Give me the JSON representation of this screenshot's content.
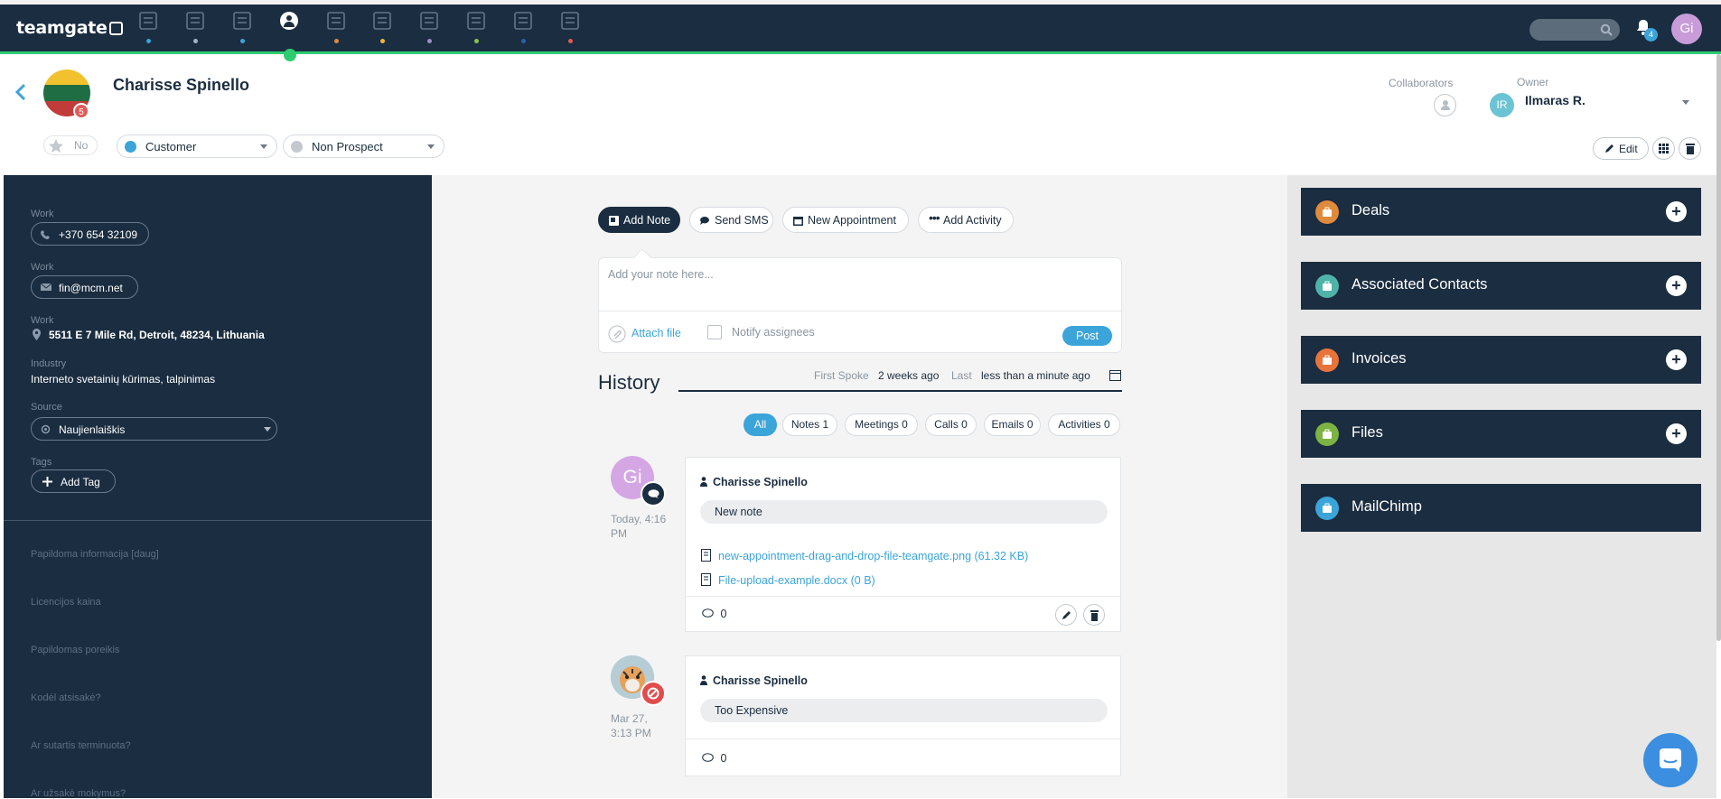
{
  "topbar": {
    "logo": "teamgate",
    "notifications_count": "4",
    "user_initials": "Gi",
    "nav_icons": [
      {
        "name": "dashboard-icon",
        "color": "#3ba4d9"
      },
      {
        "name": "target-icon",
        "color": "#9fb5c8"
      },
      {
        "name": "companies-icon",
        "color": "#3ba4d9"
      },
      {
        "name": "people-icon",
        "color": "#2ecc71"
      },
      {
        "name": "deals-icon",
        "color": "#e08a3c"
      },
      {
        "name": "calendar-icon",
        "color": "#f0b43c"
      },
      {
        "name": "leads-icon",
        "color": "#9b8ec4"
      },
      {
        "name": "clipboard-icon",
        "color": "#8bc34a"
      },
      {
        "name": "reports-icon",
        "color": "#2b5fad"
      },
      {
        "name": "invoices-icon",
        "color": "#e05a5a"
      }
    ]
  },
  "header": {
    "contact_name": "Charisse Spinello",
    "flag_badge": "5",
    "star_label": "No",
    "customer_status": "Customer",
    "prospect_status": "Non Prospect",
    "collaborators_label": "Collaborators",
    "owner_label": "Owner",
    "owner_initials": "IR",
    "owner_name": "Ilmaras R.",
    "edit_label": "Edit"
  },
  "left_panel": {
    "phone_label": "Work",
    "phone": "+370 654 32109",
    "email_label": "Work",
    "email": "fin@mcm.net",
    "address_label": "Work",
    "address": "5511 E 7 Mile Rd, Detroit, 48234, Lithuania",
    "industry_label": "Industry",
    "industry": "Interneto svetainių kūrimas, talpinimas",
    "source_label": "Source",
    "source": "Naujienlaiškis",
    "tags_label": "Tags",
    "add_tag": "Add Tag",
    "extra_fields": [
      "Papildoma informacija [daug]",
      "Licencijos kaina",
      "Papildomas poreikis",
      "Kodėl atsisakė?",
      "Ar sutartis terminuota?",
      "Ar užsakė mokymus?"
    ]
  },
  "composer": {
    "tabs": [
      "Add Note",
      "Send SMS",
      "New Appointment",
      "Add Activity"
    ],
    "placeholder": "Add your note here...",
    "attach_label": "Attach file",
    "notify_label": "Notify assignees",
    "post_label": "Post"
  },
  "history": {
    "title": "History",
    "first_spoke_label": "First Spoke",
    "first_spoke_value": "2 weeks ago",
    "last_label": "Last",
    "last_value": "less than a minute ago",
    "filters": [
      "All",
      "Notes 1",
      "Meetings 0",
      "Calls 0",
      "Emails 0",
      "Activities 0"
    ],
    "items": [
      {
        "avatar_initials": "Gi",
        "time_line1": "Today, 4:16",
        "time_line2": "PM",
        "author": "Charisse Spinello",
        "text": "New note",
        "attachments": [
          "new-appointment-drag-and-drop-file-teamgate.png (61.32 KB)",
          "File-upload-example.docx (0 B)"
        ],
        "comments": "0"
      },
      {
        "time_line1": "Mar 27,",
        "time_line2": "3:13 PM",
        "author": "Charisse Spinello",
        "text": "Too Expensive",
        "comments": "0"
      }
    ]
  },
  "right_panel": {
    "sections": [
      {
        "label": "Deals",
        "icon": "briefcase-icon",
        "color": "#e08a3c"
      },
      {
        "label": "Associated Contacts",
        "icon": "person-icon",
        "color": "#4fb3a9"
      },
      {
        "label": "Invoices",
        "icon": "invoice-icon",
        "color": "#e8743b"
      },
      {
        "label": "Files",
        "icon": "paperclip-icon",
        "color": "#7cb342"
      },
      {
        "label": "MailChimp",
        "icon": "mailchimp-icon",
        "color": "#3ba4d9"
      }
    ]
  },
  "colors": {
    "navy": "#1b2d40",
    "accent_blue": "#3ba4d9",
    "accent_green": "#2ecc71",
    "customer_dot": "#3ba4d9",
    "prospect_dot": "#c3c9cf"
  }
}
